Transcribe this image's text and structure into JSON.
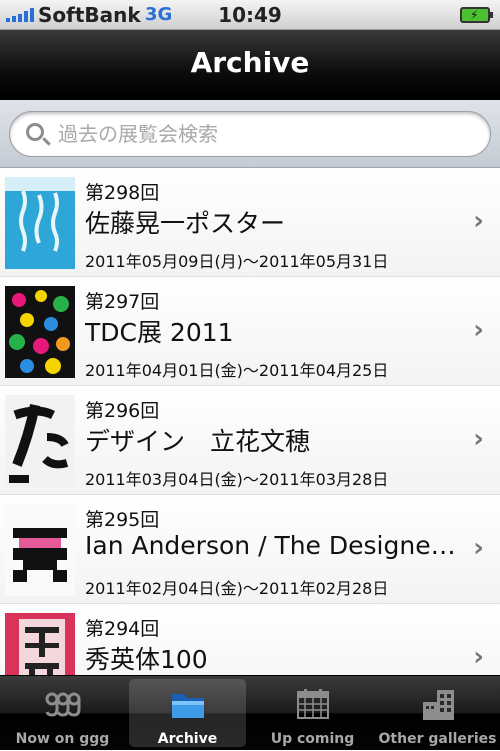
{
  "status": {
    "carrier": "SoftBank",
    "network": "3G",
    "time": "10:49"
  },
  "navbar": {
    "title": "Archive"
  },
  "search": {
    "placeholder": "過去の展覧会検索"
  },
  "exhibitions": [
    {
      "number": "第298回",
      "title": "佐藤晃一ポスター",
      "date": "2011年05月09日(月)〜2011年05月31日"
    },
    {
      "number": "第297回",
      "title": "TDC展 2011",
      "date": "2011年04月01日(金)〜2011年04月25日"
    },
    {
      "number": "第296回",
      "title": "デザイン　立花文穂",
      "date": "2011年03月04日(金)〜2011年03月28日"
    },
    {
      "number": "第295回",
      "title": "Ian Anderson / The Designers Republic",
      "date": "2011年02月04日(金)〜2011年02月28日"
    },
    {
      "number": "第294回",
      "title": "秀英体100",
      "date": ""
    }
  ],
  "tabs": [
    {
      "label": "Now on ggg",
      "icon": "ggg-logo-icon"
    },
    {
      "label": "Archive",
      "icon": "folder-icon"
    },
    {
      "label": "Up coming",
      "icon": "calendar-icon"
    },
    {
      "label": "Other galleries",
      "icon": "buildings-icon"
    }
  ],
  "colors": {
    "accent": "#2a6fd6",
    "selected_tab": "#ffffff"
  }
}
